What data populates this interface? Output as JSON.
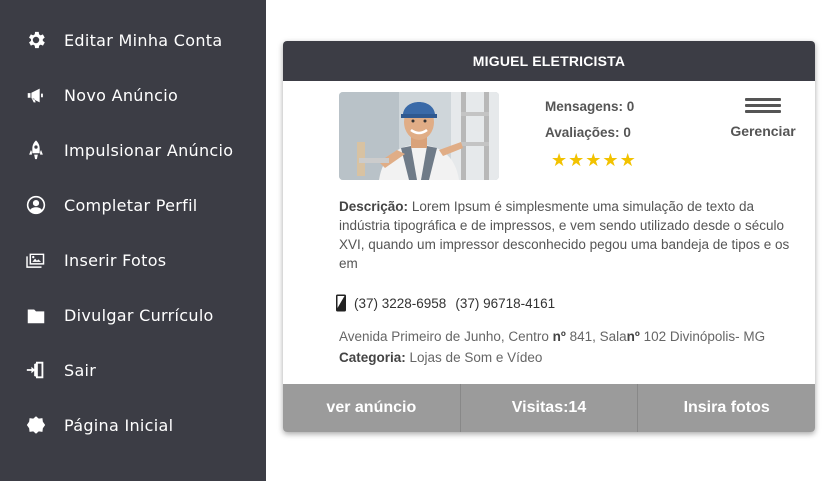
{
  "sidebar": {
    "items": [
      {
        "label": "Editar Minha Conta",
        "icon": "gear-icon"
      },
      {
        "label": "Novo Anúncio",
        "icon": "megaphone-icon"
      },
      {
        "label": "Impulsionar Anúncio",
        "icon": "rocket-icon"
      },
      {
        "label": "Completar Perfil",
        "icon": "user-circle-icon"
      },
      {
        "label": "Inserir Fotos",
        "icon": "images-icon"
      },
      {
        "label": "Divulgar Currículo",
        "icon": "briefcase-folder-icon"
      },
      {
        "label": "Sair",
        "icon": "exit-door-icon"
      },
      {
        "label": "Página Inicial",
        "icon": "home-blob-icon"
      }
    ]
  },
  "card": {
    "title": "MIGUEL ELETRICISTA",
    "stats": {
      "messages_label": "Mensagens:",
      "messages_value": "0",
      "reviews_label": "Avaliações:",
      "reviews_value": "0"
    },
    "rating": 5,
    "manage_label": "Gerenciar",
    "description_label": "Descrição:",
    "description_text": "Lorem Ipsum é simplesmente uma simulação de texto da indústria tipográfica e de impressos, e vem sendo utilizado desde o século XVI, quando um impressor desconhecido pegou uma bandeja de tipos e os em",
    "phone_1": "(37) 3228-6958",
    "phone_2": "(37) 96718-4161",
    "address_prefix": "Avenida Primeiro de Junho, Centro",
    "address_num_label": "nº",
    "address_num": "841, Sala",
    "address_room_label": "nº",
    "address_room": "102 Divinópolis- MG",
    "category_label": "Categoria:",
    "category_value": "Lojas de Som e Vídeo",
    "footer": {
      "view_label": "ver anúncio",
      "visits_label": "Visitas:14",
      "photos_label": "Insira fotos"
    }
  },
  "colors": {
    "sidebar_bg": "#3c3d45",
    "header_bg": "#3c3d45",
    "footer_bg": "#9b9b9b",
    "star": "#f2c200"
  }
}
